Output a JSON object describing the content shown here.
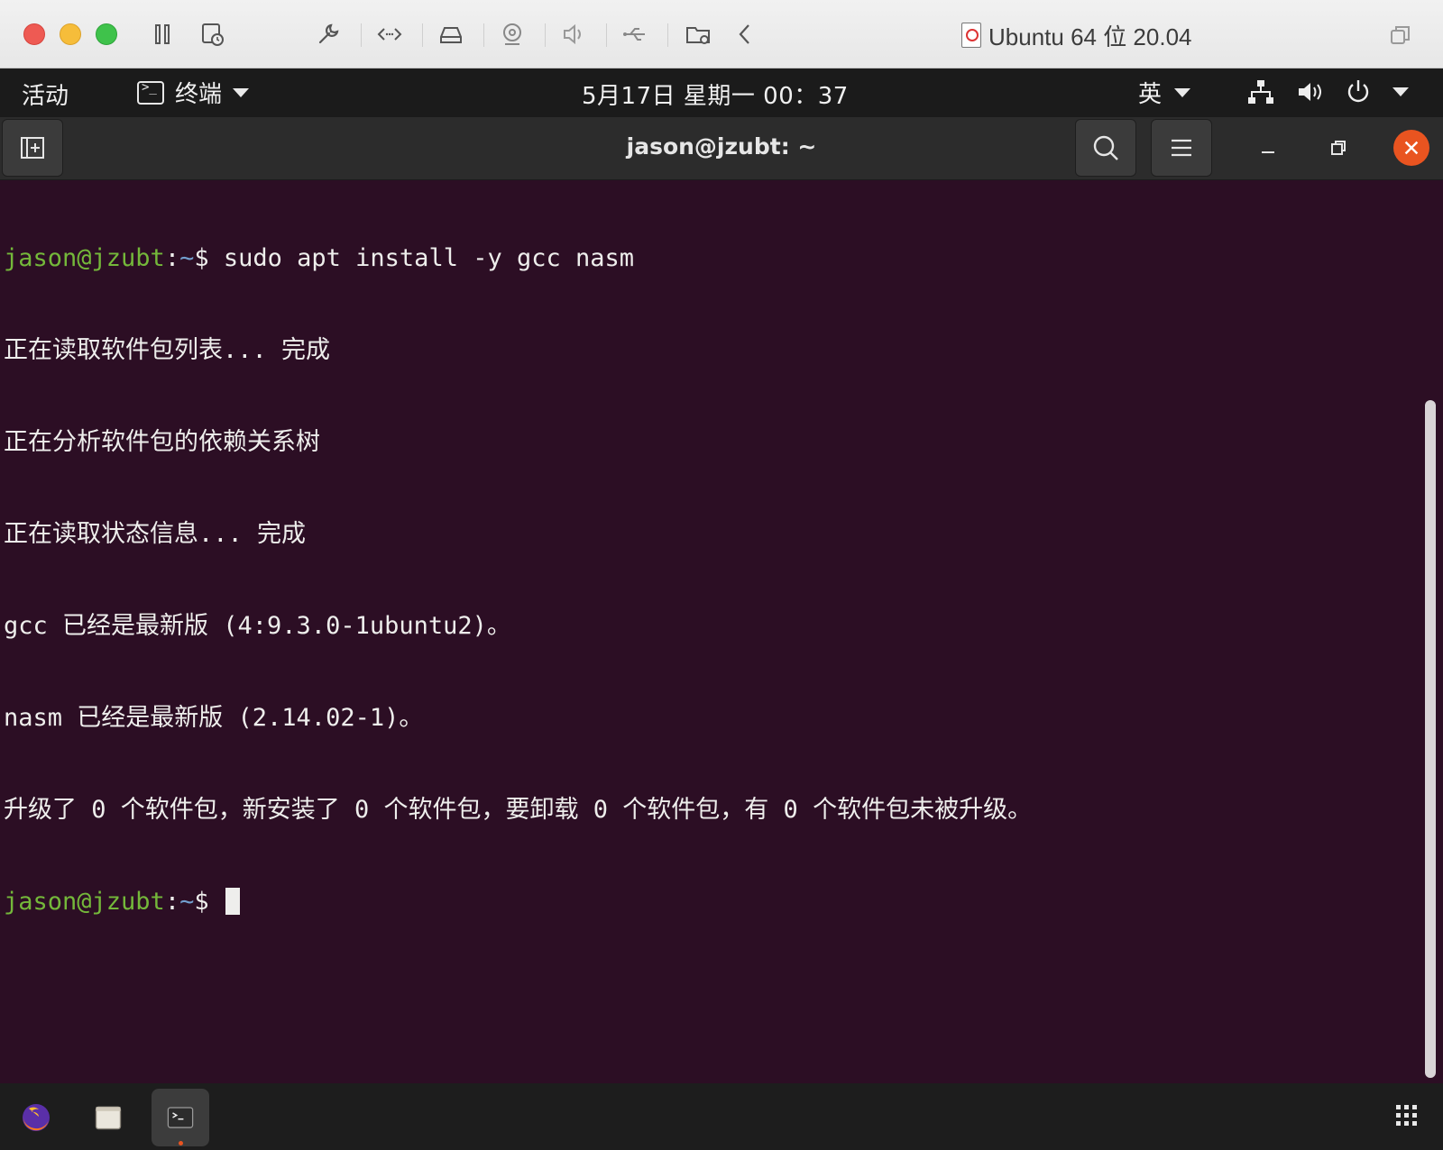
{
  "host": {
    "title": "Ubuntu 64 位 20.04"
  },
  "topbar": {
    "activities": "活动",
    "app_name": "终端",
    "clock": "5月17日 星期一  00：37",
    "input_method": "英"
  },
  "terminal": {
    "title": "jason@jzubt: ~",
    "prompt_user": "jason@jzubt",
    "prompt_path": "~",
    "prompt_symbol": "$",
    "command": " sudo apt install -y gcc nasm",
    "output": [
      "正在读取软件包列表... 完成",
      "正在分析软件包的依赖关系树",
      "正在读取状态信息... 完成",
      "gcc 已经是最新版 (4:9.3.0-1ubuntu2)。",
      "nasm 已经是最新版 (2.14.02-1)。",
      "升级了 0 个软件包，新安装了 0 个软件包，要卸载 0 个软件包，有 0 个软件包未被升级。"
    ]
  },
  "colors": {
    "terminal_bg": "#2c0e24",
    "prompt_user": "#74b83a",
    "prompt_path": "#729fcf",
    "ubuntu_orange": "#e95420"
  },
  "dock": {
    "items": [
      "firefox-icon",
      "files-icon",
      "terminal-icon"
    ],
    "active": "terminal-icon"
  }
}
